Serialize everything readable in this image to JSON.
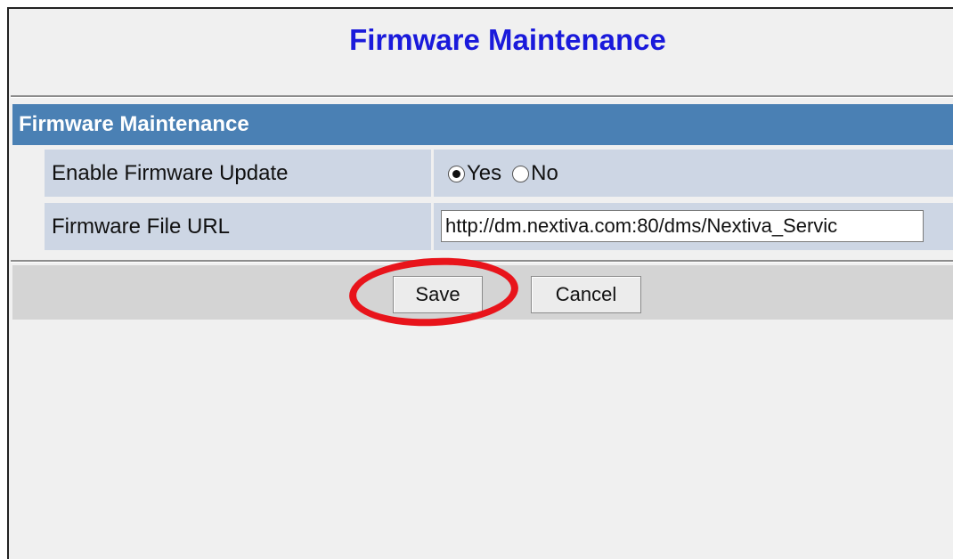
{
  "page": {
    "title": "Firmware Maintenance"
  },
  "section": {
    "header": "Firmware Maintenance",
    "rows": [
      {
        "label": "Enable Firmware Update",
        "options": [
          "Yes",
          "No"
        ],
        "selected": "Yes"
      },
      {
        "label": "Firmware File URL",
        "value": "http://dm.nextiva.com:80/dms/Nextiva_Servic"
      }
    ]
  },
  "buttons": {
    "save_label": "Save",
    "cancel_label": "Cancel"
  },
  "colors": {
    "title": "#1a1adb",
    "section_header_bg": "#4a80b4",
    "row_bg": "#cdd6e4",
    "highlight_ring": "#e8141b"
  }
}
